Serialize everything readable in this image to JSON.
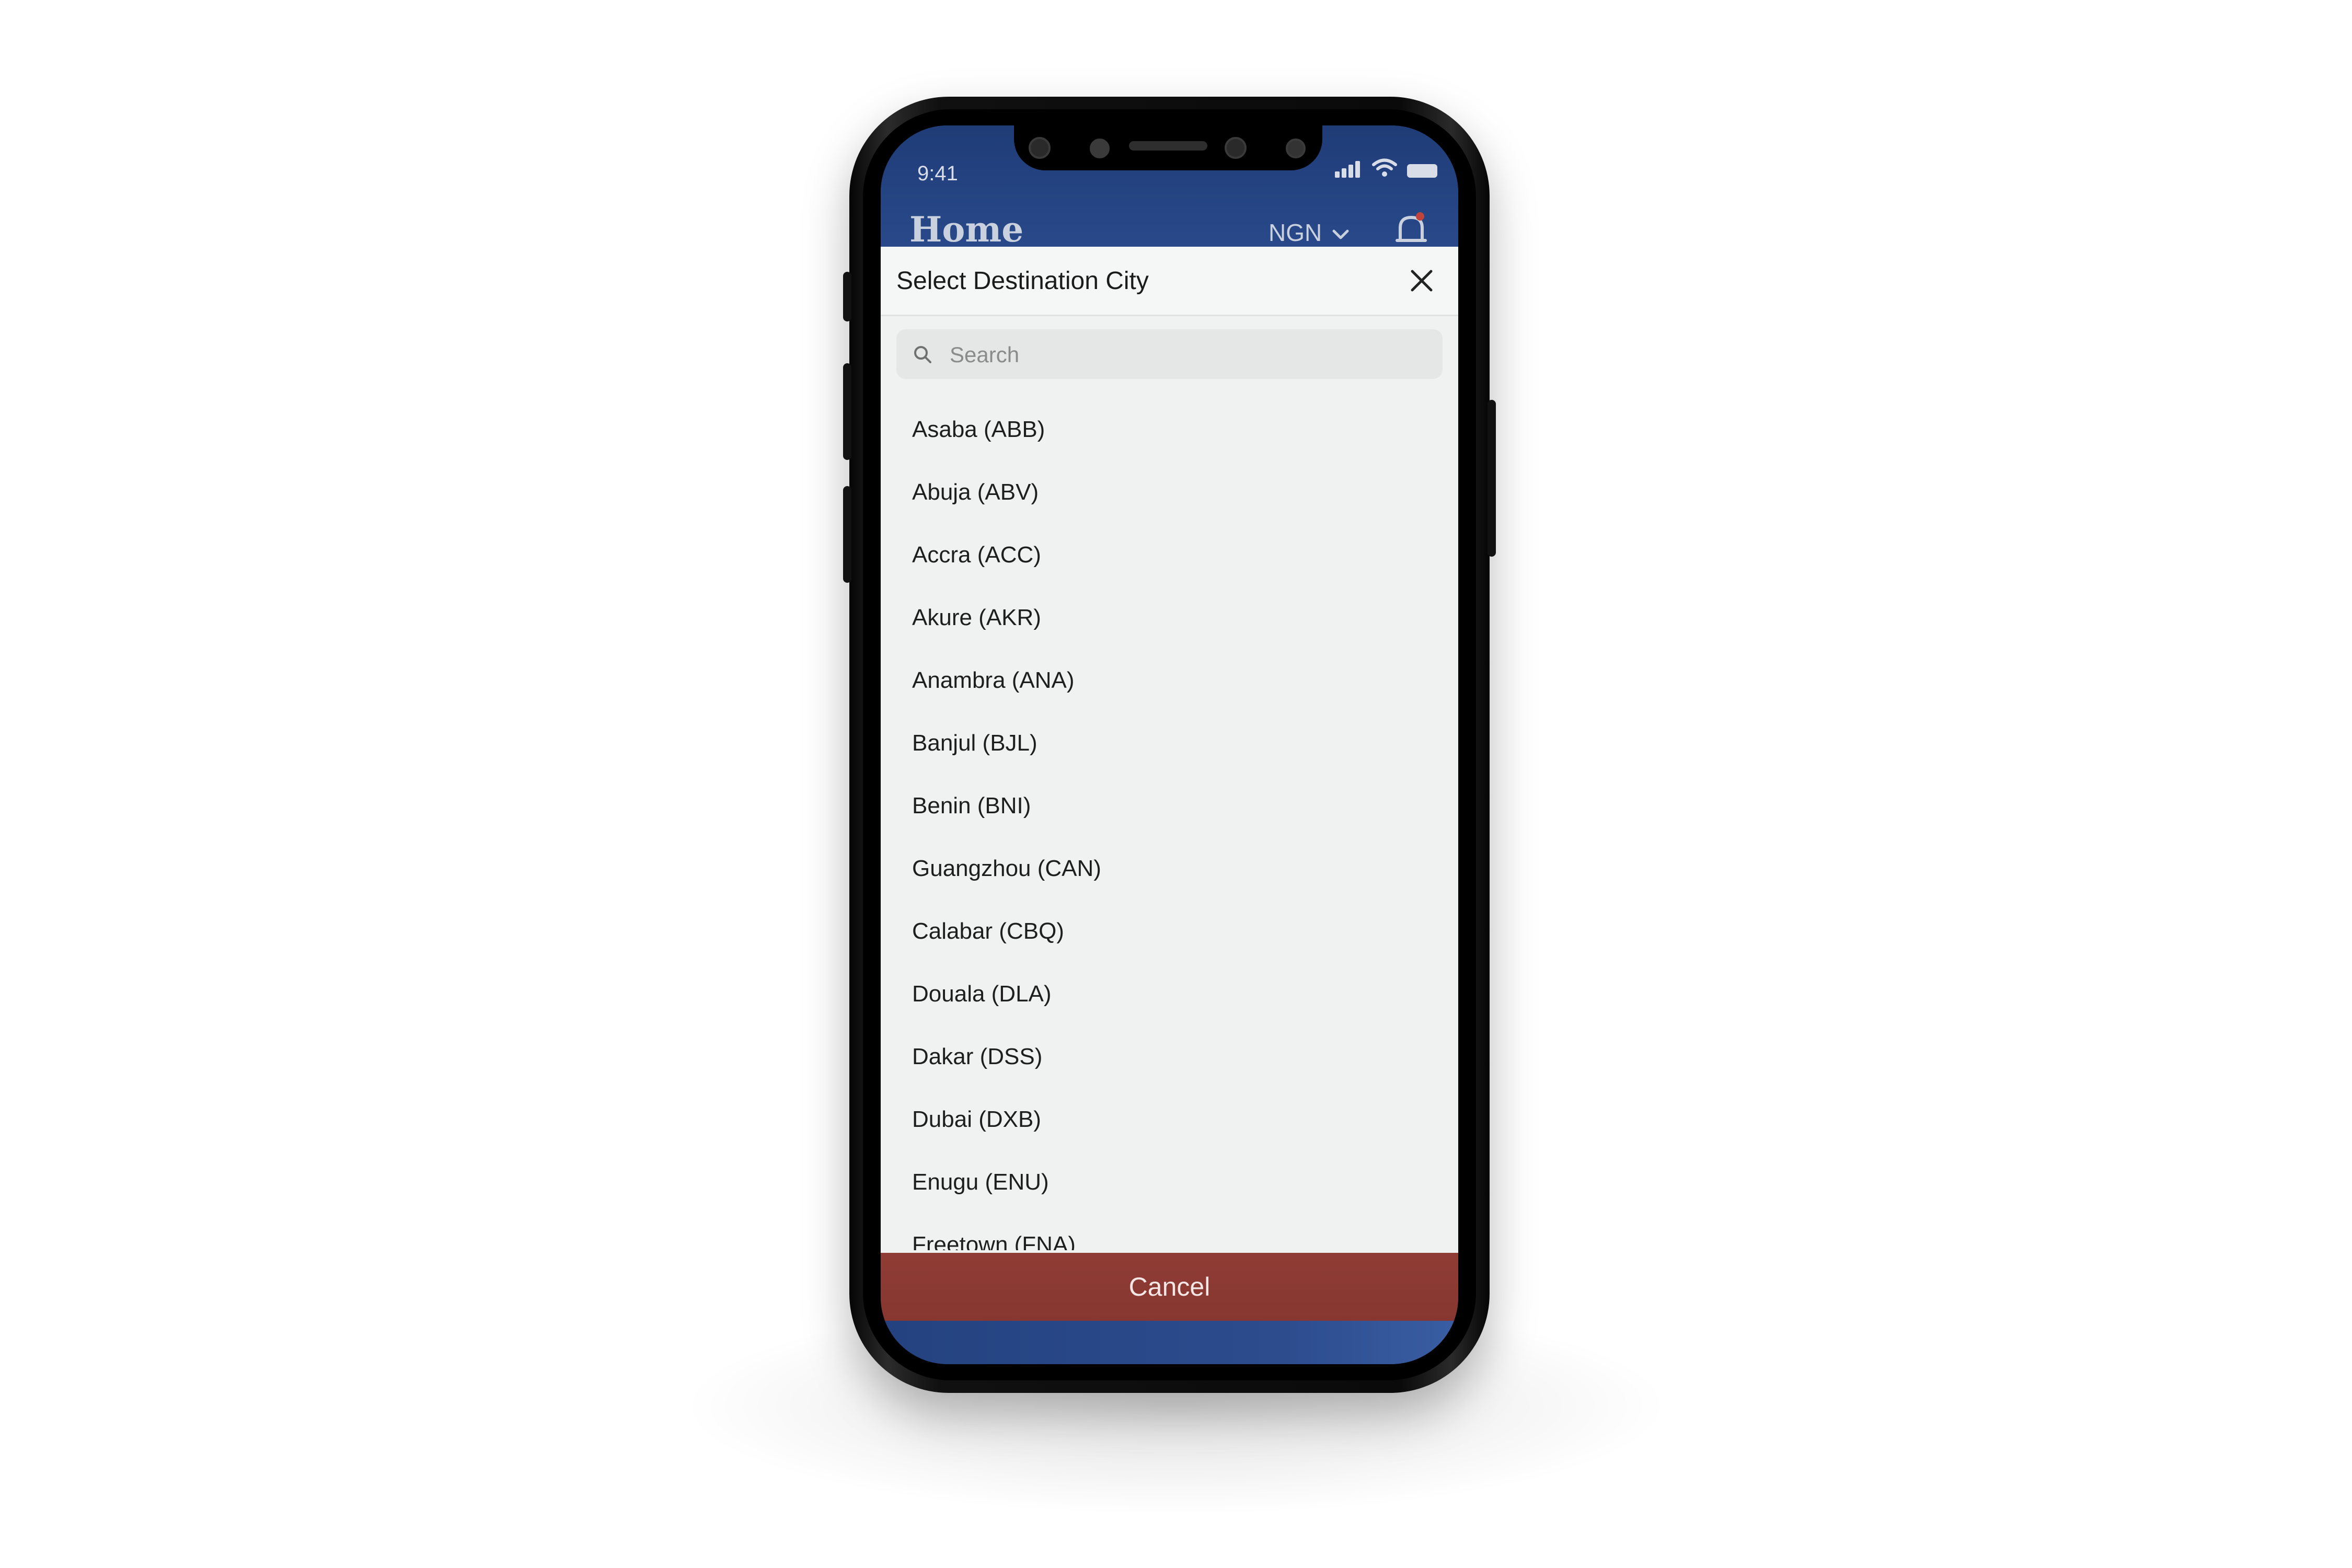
{
  "status_bar": {
    "time": "9:41"
  },
  "app_header": {
    "title": "Home",
    "currency": "NGN"
  },
  "modal": {
    "title": "Select Destination City",
    "search": {
      "placeholder": "Search",
      "value": ""
    },
    "cities": [
      "Asaba (ABB)",
      "Abuja (ABV)",
      "Accra (ACC)",
      "Akure (AKR)",
      "Anambra (ANA)",
      "Banjul (BJL)",
      "Benin (BNI)",
      "Guangzhou (CAN)",
      "Calabar (CBQ)",
      "Douala (DLA)",
      "Dakar (DSS)",
      "Dubai (DXB)",
      "Enugu (ENU)",
      "Freetown (FNA)"
    ],
    "cancel_label": "Cancel"
  },
  "colors": {
    "header_blue": "#24427f",
    "cancel_red": "#8b3a33",
    "sheet_bg": "#f0f1f1"
  }
}
